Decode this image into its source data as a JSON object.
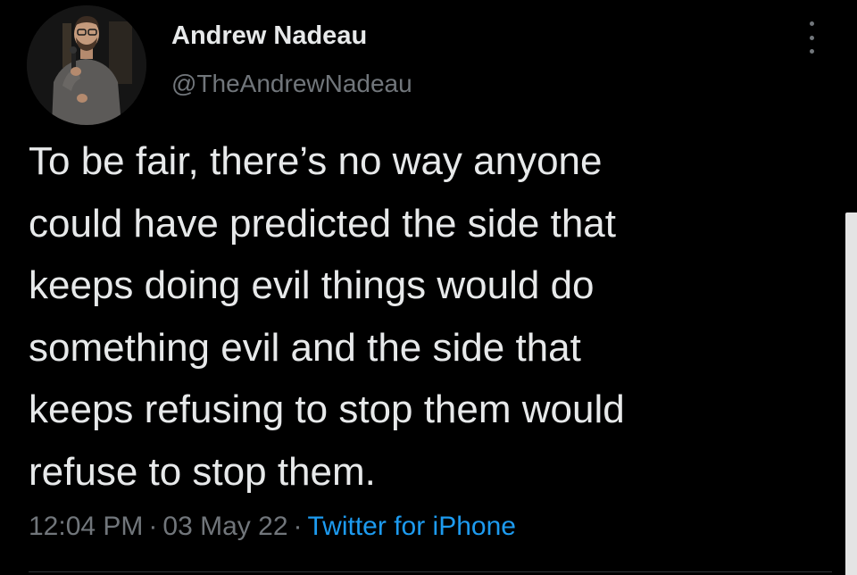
{
  "tweet": {
    "author": {
      "name": "Andrew Nadeau",
      "handle": "@TheAndrewNadeau"
    },
    "text_lines": [
      "To be fair, there’s no way anyone",
      "could have predicted the side that",
      "keeps doing evil things would do",
      "something evil and the side that",
      "keeps refusing to stop them would",
      "refuse to stop them."
    ],
    "meta": {
      "time": "12:04 PM",
      "date": "03 May 22",
      "separator": "·",
      "source": "Twitter for iPhone"
    }
  },
  "colors": {
    "background": "#000000",
    "text": "#e7e9ea",
    "secondary": "#71767b",
    "link": "#1d9bf0"
  },
  "icons": {
    "more": "more-vertical-icon",
    "avatar": "profile-photo"
  }
}
